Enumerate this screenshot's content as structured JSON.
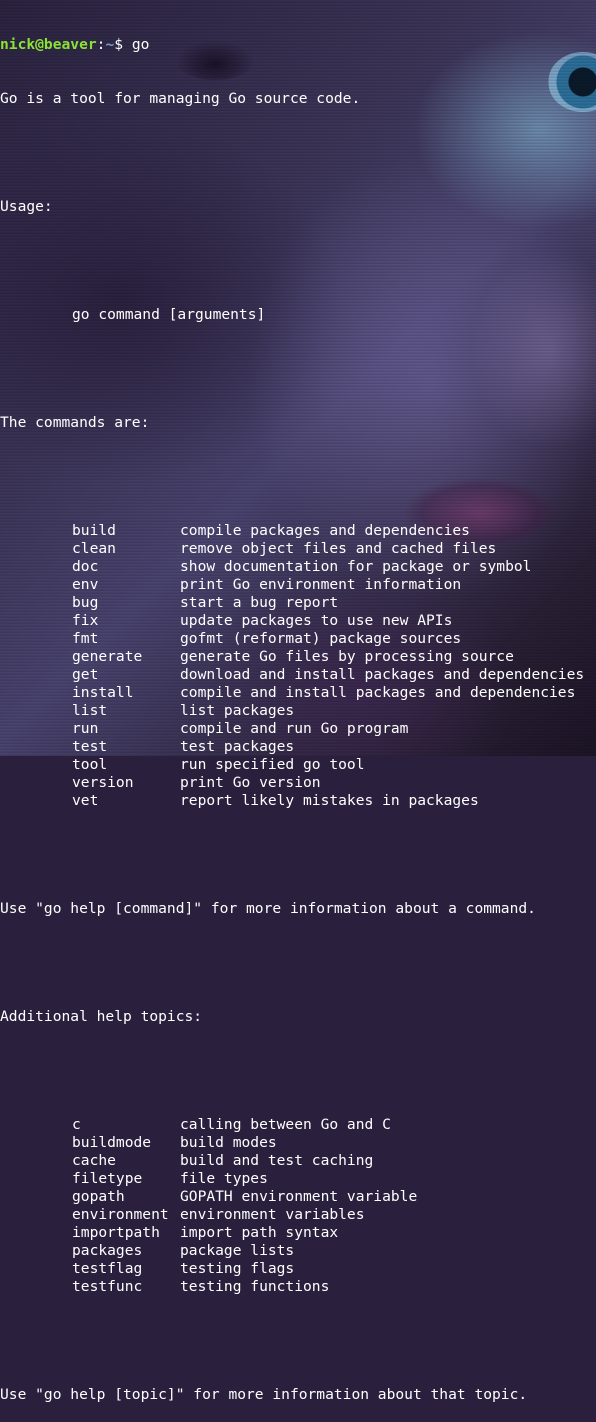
{
  "prompt": {
    "user_host": "nick@beaver",
    "colon": ":",
    "path": "~",
    "symbol": "$",
    "command": " go"
  },
  "intro": "Go is a tool for managing Go source code.",
  "usage_label": "Usage:",
  "usage_line": "go command [arguments]",
  "commands_label": "The commands are:",
  "commands": [
    {
      "name": "build",
      "desc": "compile packages and dependencies"
    },
    {
      "name": "clean",
      "desc": "remove object files and cached files"
    },
    {
      "name": "doc",
      "desc": "show documentation for package or symbol"
    },
    {
      "name": "env",
      "desc": "print Go environment information"
    },
    {
      "name": "bug",
      "desc": "start a bug report"
    },
    {
      "name": "fix",
      "desc": "update packages to use new APIs"
    },
    {
      "name": "fmt",
      "desc": "gofmt (reformat) package sources"
    },
    {
      "name": "generate",
      "desc": "generate Go files by processing source"
    },
    {
      "name": "get",
      "desc": "download and install packages and dependencies"
    },
    {
      "name": "install",
      "desc": "compile and install packages and dependencies"
    },
    {
      "name": "list",
      "desc": "list packages"
    },
    {
      "name": "run",
      "desc": "compile and run Go program"
    },
    {
      "name": "test",
      "desc": "test packages"
    },
    {
      "name": "tool",
      "desc": "run specified go tool"
    },
    {
      "name": "version",
      "desc": "print Go version"
    },
    {
      "name": "vet",
      "desc": "report likely mistakes in packages"
    }
  ],
  "command_help_hint": "Use \"go help [command]\" for more information about a command.",
  "topics_label": "Additional help topics:",
  "topics": [
    {
      "name": "c",
      "desc": "calling between Go and C"
    },
    {
      "name": "buildmode",
      "desc": "build modes"
    },
    {
      "name": "cache",
      "desc": "build and test caching"
    },
    {
      "name": "filetype",
      "desc": "file types"
    },
    {
      "name": "gopath",
      "desc": "GOPATH environment variable"
    },
    {
      "name": "environment",
      "desc": "environment variables"
    },
    {
      "name": "importpath",
      "desc": "import path syntax"
    },
    {
      "name": "packages",
      "desc": "package lists"
    },
    {
      "name": "testflag",
      "desc": "testing flags"
    },
    {
      "name": "testfunc",
      "desc": "testing functions"
    }
  ],
  "topic_help_hint": "Use \"go help [topic]\" for more information about that topic.",
  "colors": {
    "prompt_user": "#8ae234",
    "prompt_path": "#729fcf",
    "text": "#ffffff"
  },
  "wallpaper": "portrait-wallpaper"
}
